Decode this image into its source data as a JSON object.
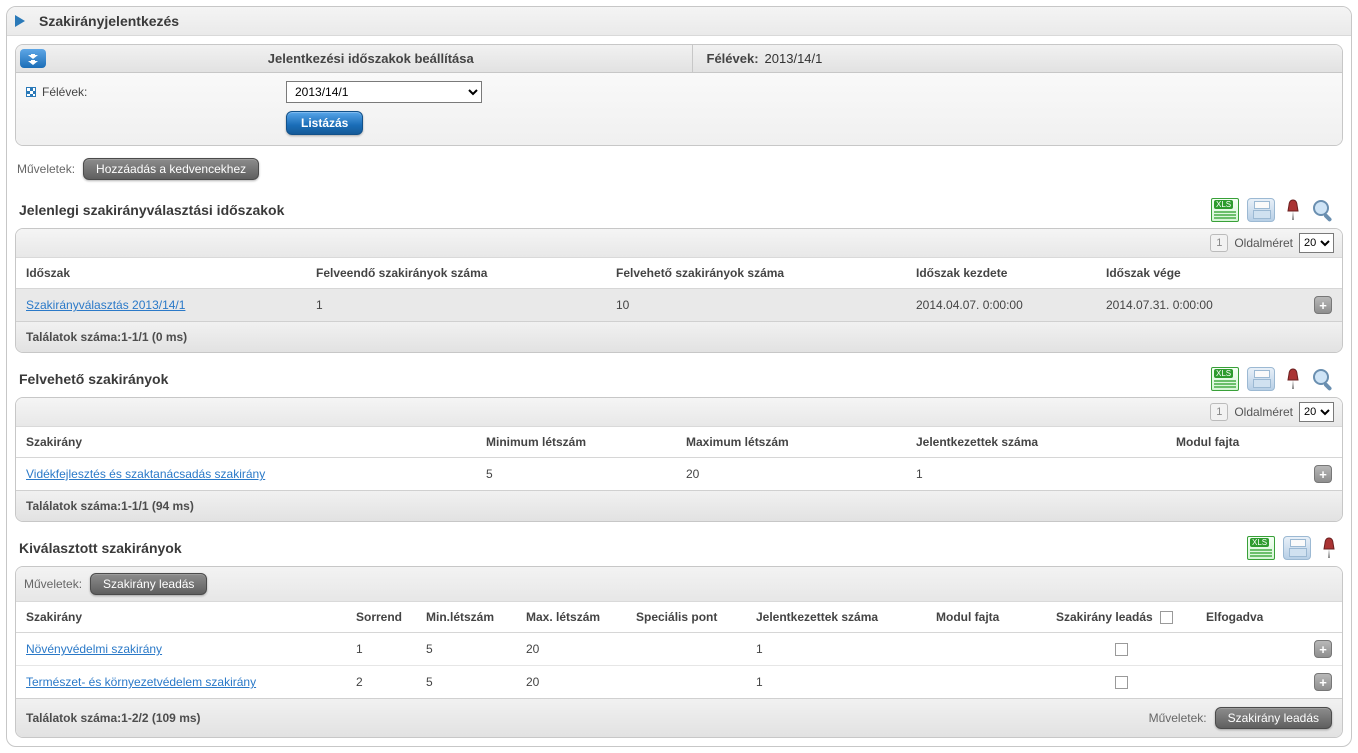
{
  "page": {
    "title": "Szakirányjelentkezés"
  },
  "filter": {
    "header_left": "Jelentkezési időszakok beállítása",
    "header_right_label": "Félévek:",
    "header_right_value": "2013/14/1",
    "field_label": "Félévek:",
    "select_value": "2013/14/1",
    "list_button": "Listázás"
  },
  "top_actions": {
    "label": "Műveletek:",
    "add_fav": "Hozzáadás a kedvencekhez"
  },
  "pagesize": {
    "label": "Oldalméret",
    "value": "20",
    "page": "1"
  },
  "section1": {
    "title": "Jelenlegi szakirányválasztási időszakok",
    "columns": {
      "c1": "Időszak",
      "c2": "Felveendő szakirányok száma",
      "c3": "Felvehető szakirányok száma",
      "c4": "Időszak kezdete",
      "c5": "Időszak vége"
    },
    "rows": [
      {
        "c1": "Szakirányválasztás 2013/14/1",
        "c2": "1",
        "c3": "10",
        "c4": "2014.04.07. 0:00:00",
        "c5": "2014.07.31. 0:00:00"
      }
    ],
    "footer": "Találatok száma:1-1/1 (0 ms)"
  },
  "section2": {
    "title": "Felvehető szakirányok",
    "columns": {
      "c1": "Szakirány",
      "c2": "Minimum létszám",
      "c3": "Maximum létszám",
      "c4": "Jelentkezettek száma",
      "c5": "Modul fajta"
    },
    "rows": [
      {
        "c1": "Vidékfejlesztés és szaktanácsadás szakirány",
        "c2": "5",
        "c3": "20",
        "c4": "1",
        "c5": ""
      }
    ],
    "footer": "Találatok száma:1-1/1 (94 ms)"
  },
  "section3": {
    "title": "Kiválasztott szakirányok",
    "inner_actions_label": "Műveletek:",
    "inner_action_btn": "Szakirány leadás",
    "columns": {
      "c1": "Szakirány",
      "c2": "Sorrend",
      "c3": "Min.létszám",
      "c4": "Max. létszám",
      "c5": "Speciális pont",
      "c6": "Jelentkezettek száma",
      "c7": "Modul fajta",
      "c8": "Szakirány leadás",
      "c9": "Elfogadva"
    },
    "rows": [
      {
        "c1": "Növényvédelmi szakirány",
        "c2": "1",
        "c3": "5",
        "c4": "20",
        "c5": "",
        "c6": "1",
        "c7": ""
      },
      {
        "c1": "Természet- és környezetvédelem szakirány",
        "c2": "2",
        "c3": "5",
        "c4": "20",
        "c5": "",
        "c6": "1",
        "c7": ""
      }
    ],
    "footer_left": "Találatok száma:1-2/2 (109 ms)",
    "footer_actions_label": "Műveletek:",
    "footer_action_btn": "Szakirány leadás"
  }
}
